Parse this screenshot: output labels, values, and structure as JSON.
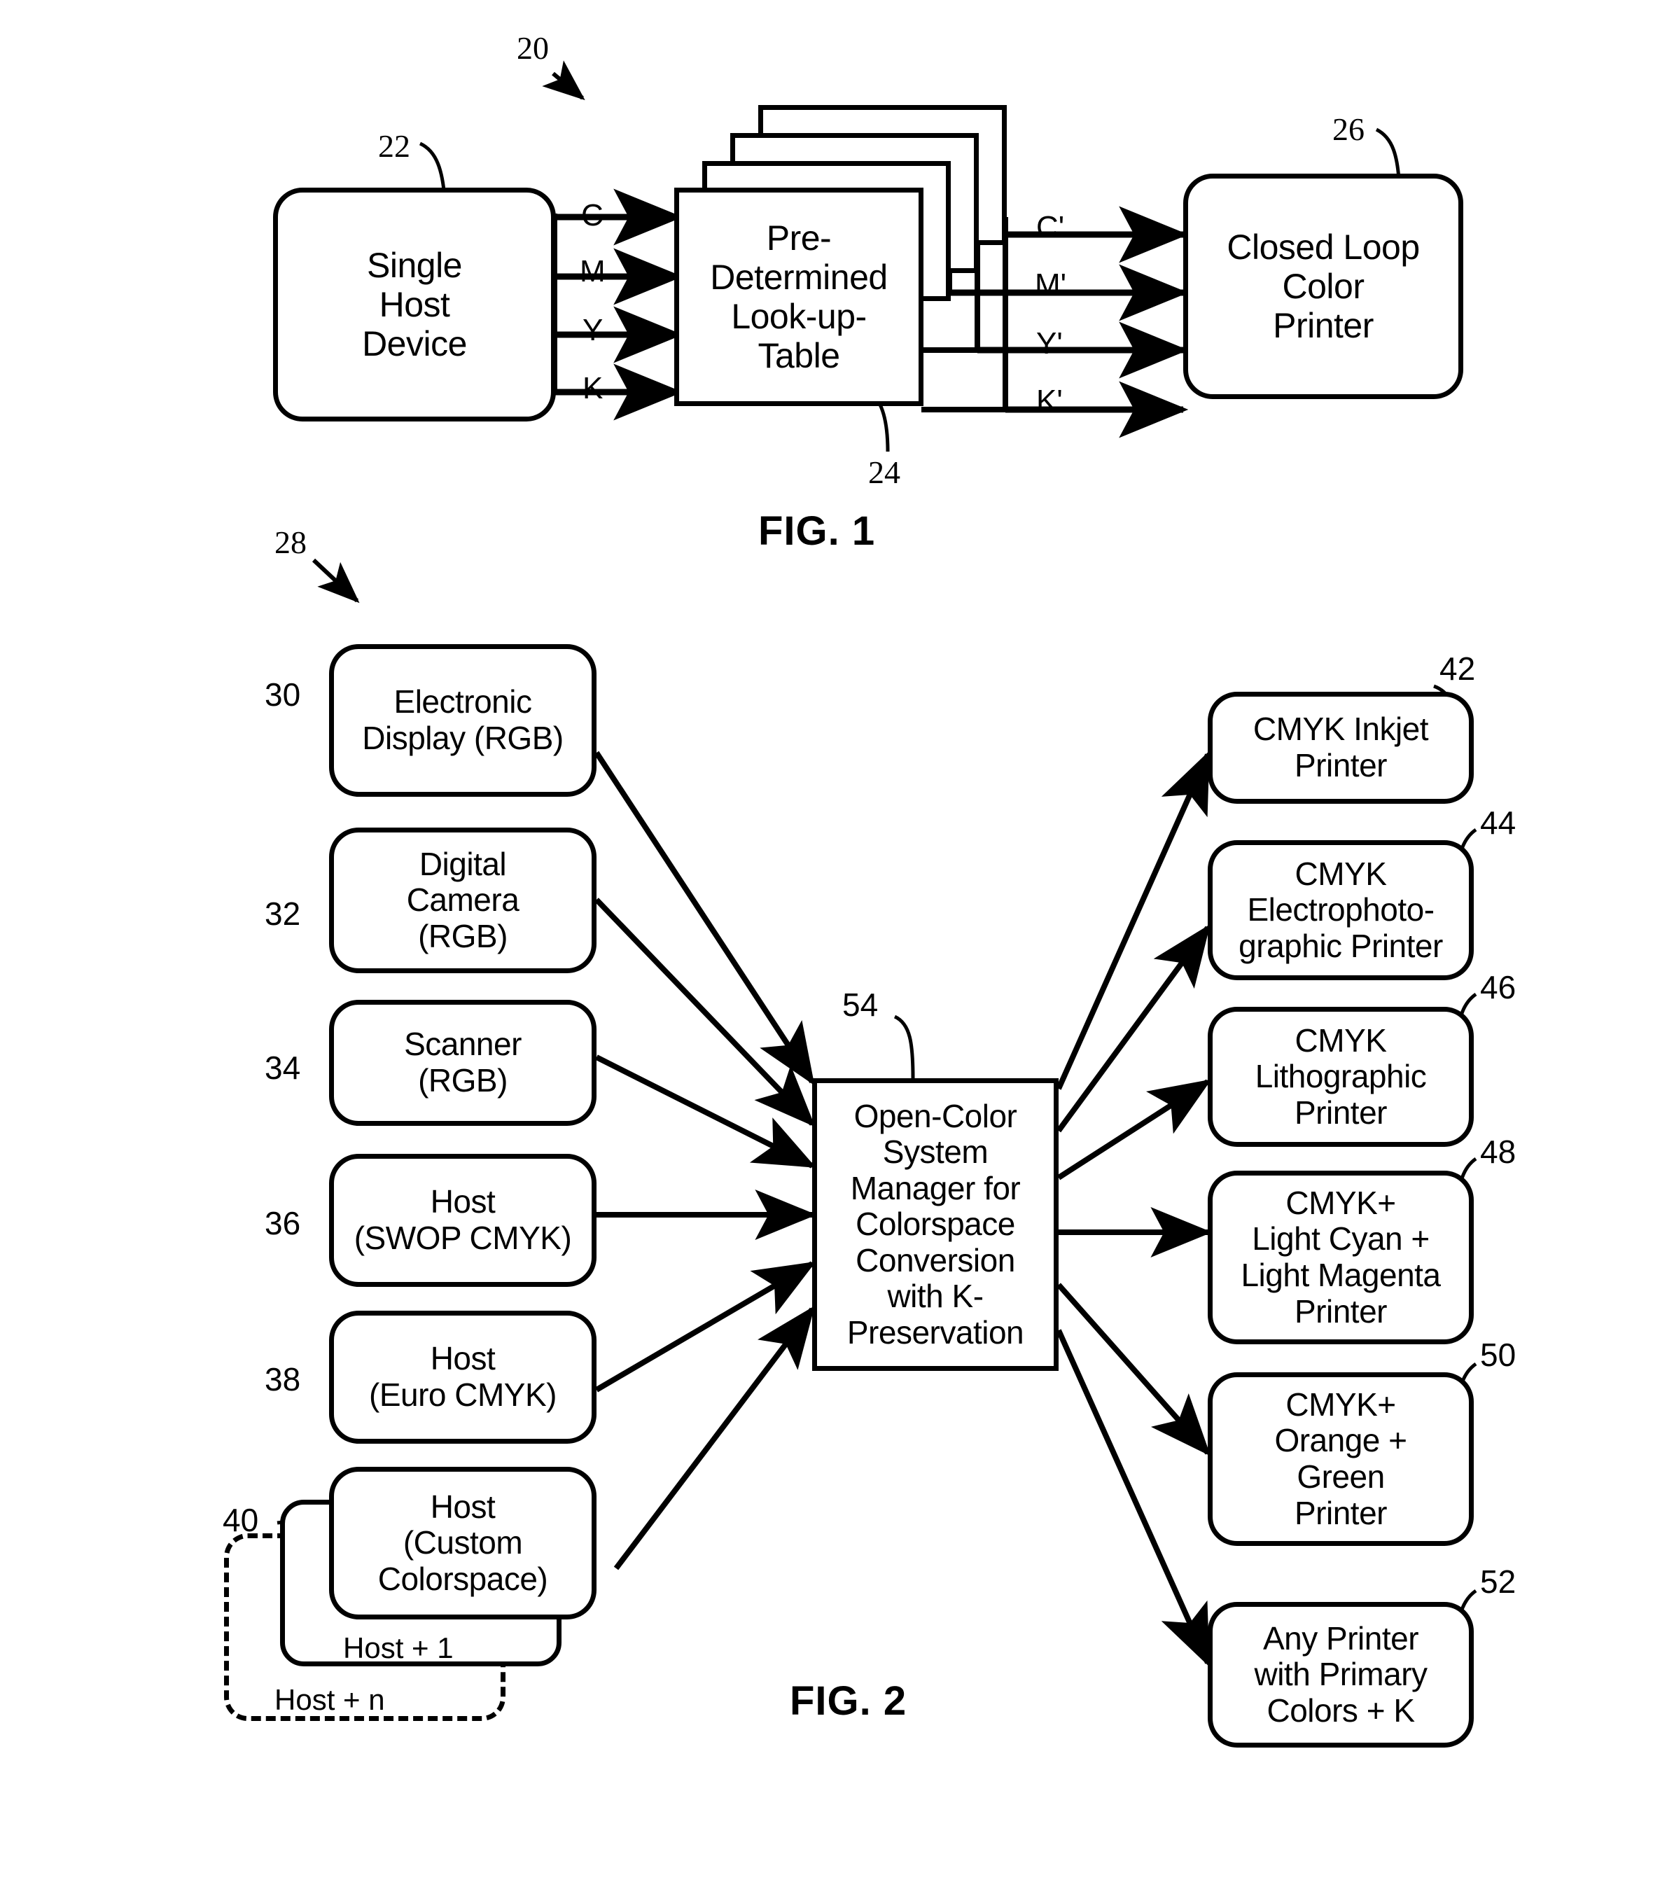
{
  "figures": [
    {
      "id": "fig1",
      "caption": "FIG. 1",
      "ref": "20",
      "nodes": [
        {
          "ref": "22",
          "label": "Single\nHost\nDevice"
        },
        {
          "ref": "24",
          "label": "Pre-\nDetermined\nLook-up-\nTable"
        },
        {
          "ref": "26",
          "label": "Closed Loop\nColor\nPrinter"
        }
      ],
      "input_signals": [
        "C",
        "M",
        "Y",
        "K"
      ],
      "output_signals": [
        "C'",
        "M'",
        "Y'",
        "K'"
      ],
      "lut_stack_count": 4
    },
    {
      "id": "fig2",
      "caption": "FIG. 2",
      "ref": "28",
      "manager": {
        "ref": "54",
        "label": "Open-Color\nSystem\nManager for\nColorspace\nConversion\nwith K-\nPreservation"
      },
      "inputs": [
        {
          "ref": "30",
          "label": "Electronic\nDisplay (RGB)"
        },
        {
          "ref": "32",
          "label": "Digital\nCamera\n(RGB)"
        },
        {
          "ref": "34",
          "label": "Scanner\n(RGB)"
        },
        {
          "ref": "36",
          "label": "Host\n(SWOP CMYK)"
        },
        {
          "ref": "38",
          "label": "Host\n(Euro CMYK)"
        },
        {
          "ref": "40",
          "label": "Host\n(Custom\nColorspace)"
        }
      ],
      "input_stack": [
        {
          "label": "Host  + 1",
          "style": "solid"
        },
        {
          "label": "Host + n",
          "style": "dashed"
        }
      ],
      "outputs": [
        {
          "ref": "42",
          "label": "CMYK Inkjet\nPrinter"
        },
        {
          "ref": "44",
          "label": "CMYK\nElectrophoto-\ngraphic Printer"
        },
        {
          "ref": "46",
          "label": "CMYK\nLithographic\nPrinter"
        },
        {
          "ref": "48",
          "label": "CMYK+\nLight Cyan +\nLight Magenta\nPrinter"
        },
        {
          "ref": "50",
          "label": "CMYK+\nOrange +\nGreen\nPrinter"
        },
        {
          "ref": "52",
          "label": "Any Printer\nwith Primary\nColors + K"
        }
      ]
    }
  ],
  "colors": {
    "ink": "#000000",
    "paper": "#ffffff"
  }
}
